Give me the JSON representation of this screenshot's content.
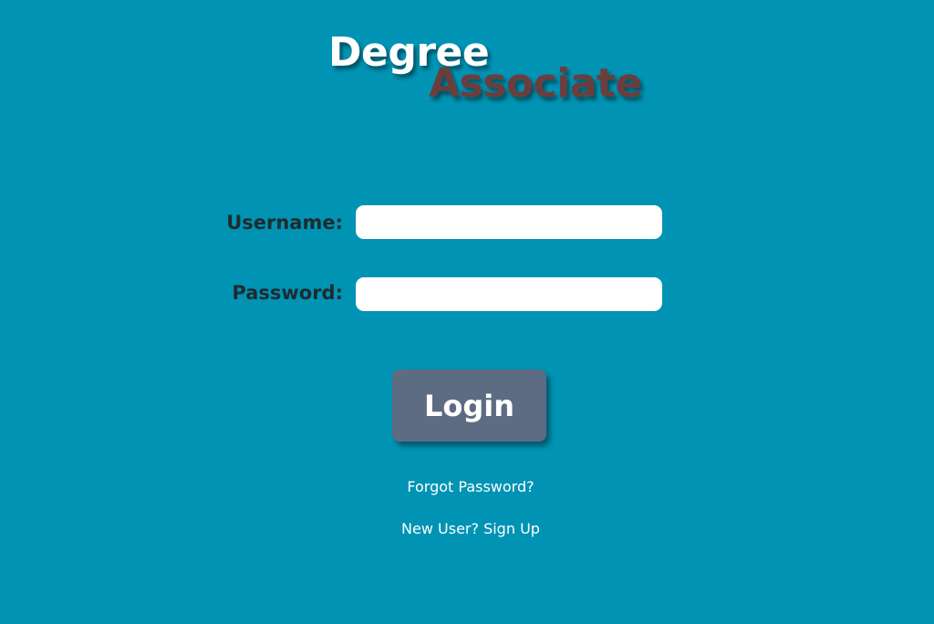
{
  "brand": {
    "word1": "Degree",
    "word2": "Associate"
  },
  "form": {
    "username_label": "Username:",
    "username_value": "",
    "password_label": "Password:",
    "password_value": "",
    "login_label": "Login"
  },
  "links": {
    "forgot_password": "Forgot Password?",
    "sign_up": "New User? Sign Up"
  },
  "colors": {
    "background": "#0093b3",
    "logo_primary": "#ffffff",
    "logo_secondary": "#6b3e3e",
    "button": "#5d6b83",
    "label_text": "#1d2b30"
  }
}
